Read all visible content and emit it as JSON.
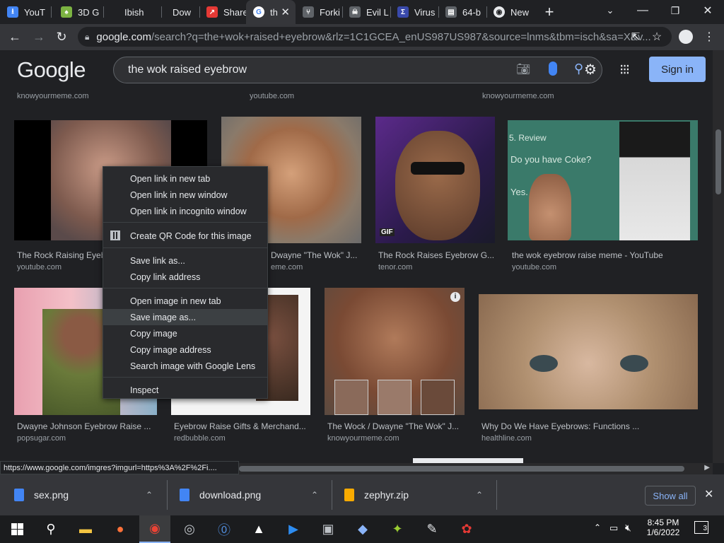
{
  "tabs": [
    {
      "title": "YouT",
      "icon": "download-icon",
      "color": "#4285f4"
    },
    {
      "title": "3D G",
      "icon": "dragon-icon",
      "color": "#7cb342"
    },
    {
      "title": "Ibish",
      "icon": "blank-page-icon",
      "color": "#202124"
    },
    {
      "title": "Dow",
      "icon": "blank-page-icon",
      "color": "#202124"
    },
    {
      "title": "Share",
      "icon": "share-icon",
      "color": "#e53935"
    },
    {
      "title": "th",
      "icon": "google-icon",
      "color": "#4285f4",
      "active": true
    },
    {
      "title": "Forki",
      "icon": "fork-icon",
      "color": "#9aa0a6"
    },
    {
      "title": "Evil L",
      "icon": "skull-icon",
      "color": "#9aa0a6"
    },
    {
      "title": "Virus",
      "icon": "sigma-icon",
      "color": "#3949ab"
    },
    {
      "title": "64-b",
      "icon": "page-icon",
      "color": "#9aa0a6"
    },
    {
      "title": "New",
      "icon": "chrome-icon",
      "color": "#9aa0a6"
    }
  ],
  "omnibox": {
    "host": "google.com",
    "path": "/search?q=the+wok+raised+eyebrow&rlz=1C1GCEA_enUS987US987&source=lnms&tbm=isch&sa=X&v..."
  },
  "google": {
    "logo": "Google",
    "query": "the wok raised eyebrow",
    "signin": "Sign in"
  },
  "top_sources": [
    "knowyourmeme.com",
    "youtube.com",
    "knowyourmeme.com"
  ],
  "row1": [
    {
      "title": "The Rock Raising Eyeb",
      "source": "youtube.com"
    },
    {
      "title": "Dwayne \"The Wok\" J...",
      "source": "eme.com"
    },
    {
      "title": "The Rock Raises Eyebrow G...",
      "source": "tenor.com",
      "badge": "GIF"
    },
    {
      "title": "the wok eyebrow raise meme - YouTube",
      "source": "youtube.com",
      "overlay": [
        "5. Review",
        "Do you have Coke?",
        "Yes."
      ]
    }
  ],
  "row2": [
    {
      "title": "Dwayne Johnson Eyebrow Raise ...",
      "source": "popsugar.com"
    },
    {
      "title": "Eyebrow Raise Gifts & Merchand...",
      "source": "redbubble.com"
    },
    {
      "title": "The Wock / Dwayne \"The Wok\" J...",
      "source": "knowyourmeme.com"
    },
    {
      "title": "Why Do We Have Eyebrows: Functions ...",
      "source": "healthline.com"
    }
  ],
  "context_menu": [
    "Open link in new tab",
    "Open link in new window",
    "Open link in incognito window",
    "Create QR Code for this image",
    "Save link as...",
    "Copy link address",
    "Open image in new tab",
    "Save image as...",
    "Copy image",
    "Copy image address",
    "Search image with Google Lens",
    "Inspect"
  ],
  "status_url": "https://www.google.com/imgres?imgurl=https%3A%2F%2Fi....",
  "downloads": [
    "sex.png",
    "download.png",
    "zephyr.zip"
  ],
  "show_all": "Show all",
  "clock": {
    "time": "8:45 PM",
    "date": "1/6/2022"
  },
  "notif_count": "3",
  "colors": {
    "accent": "#8ab4f8",
    "background": "#202124",
    "toolbar": "#35363a"
  }
}
